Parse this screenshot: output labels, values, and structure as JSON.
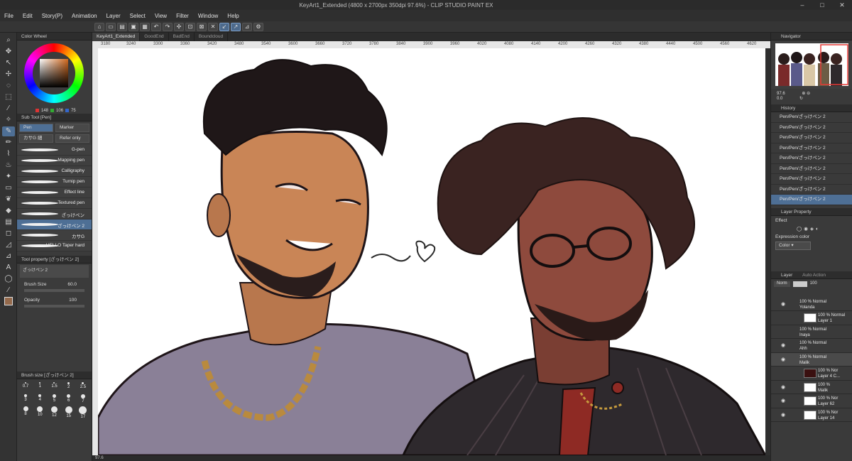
{
  "titlebar": {
    "title": "KeyArt1_Extended (4800 x 2700px 350dpi 97.6%)  - CLIP STUDIO PAINT EX",
    "minimize": "–",
    "maximize": "□",
    "close": "✕"
  },
  "menu": [
    "File",
    "Edit",
    "Story(P)",
    "Animation",
    "Layer",
    "Select",
    "View",
    "Filter",
    "Window",
    "Help"
  ],
  "doc_tabs": [
    "KeyArt1_Extended",
    "GoodEnd",
    "BadEnd",
    "Boundcloud"
  ],
  "ruler_ticks": [
    "3180",
    "3240",
    "3300",
    "3360",
    "3420",
    "3480",
    "3540",
    "3600",
    "3660",
    "3720",
    "3780",
    "3840",
    "3900",
    "3960",
    "4020",
    "4080",
    "4140",
    "4200",
    "4260",
    "4320",
    "4380",
    "4440",
    "4500",
    "4560",
    "4620"
  ],
  "color_wheel": {
    "title": "Color Wheel",
    "r": "148",
    "g": "106",
    "b": "75",
    "current_color": "#94694b"
  },
  "sub_tool": {
    "title": "Sub Tool [Pen]",
    "tabs": [
      "Pen",
      "Marker",
      "カサG 細",
      "Refer only"
    ],
    "brushes": [
      "G-pen",
      "Mapping pen",
      "Calligraphy",
      "Turnip pen",
      "Effect line",
      "Textured pen",
      "ざっけペン",
      "ざっけペン 2",
      "カサG",
      "HELLO Taper hard"
    ],
    "selected_brush": "ざっけペン 2"
  },
  "tool_property": {
    "title": "Tool property [ざっけペン 2]",
    "preset": "ざっけペン 2",
    "brush_size_label": "Brush Size",
    "brush_size": "60.0",
    "opacity_label": "Opacity",
    "opacity": "100"
  },
  "brush_size_palette": {
    "title": "Brush size [ざっけペン 2]",
    "sizes": [
      "0.7",
      "1",
      "1.5",
      "2",
      "2.5",
      "3",
      "4",
      "5",
      "6",
      "7",
      "8",
      "10",
      "12",
      "15",
      "17"
    ]
  },
  "navigator": {
    "title": "Navigator",
    "zoom": "97.6",
    "angle": "0.0"
  },
  "history": {
    "title": "History",
    "items": [
      "Pen/Pen/ざっけペン 2",
      "Pen/Pen/ざっけペン 2",
      "Pen/Pen/ざっけペン 2",
      "Pen/Pen/ざっけペン 2",
      "Pen/Pen/ざっけペン 2",
      "Pen/Pen/ざっけペン 2",
      "Pen/Pen/ざっけペン 2",
      "Pen/Pen/ざっけペン 2",
      "Pen/Pen/ざっけペン 2"
    ]
  },
  "layer_property": {
    "title": "Layer Property",
    "effect_label": "Effect",
    "expression_label": "Expression color",
    "expression_value": "Color"
  },
  "layers": {
    "title": "Layer",
    "tab2": "Auto Action",
    "blend": "Norm",
    "opacity": "100",
    "items": [
      {
        "pct": "100 % Normal",
        "name": "Yolanda"
      },
      {
        "pct": "100 % Normal",
        "name": "Layer 1"
      },
      {
        "pct": "100 % Normal",
        "name": "Inaya"
      },
      {
        "pct": "100 % Normal",
        "name": "Ahh"
      },
      {
        "pct": "100 % Normal",
        "name": "Malik"
      },
      {
        "pct": "100 % Nor",
        "name": "Layer 4 C..."
      },
      {
        "pct": "100 %",
        "name": "Malik"
      },
      {
        "pct": "100 % Nor",
        "name": "Layer 62"
      },
      {
        "pct": "100 % Nor",
        "name": "Layer 14"
      }
    ]
  },
  "status": {
    "zoom": "97.6"
  }
}
